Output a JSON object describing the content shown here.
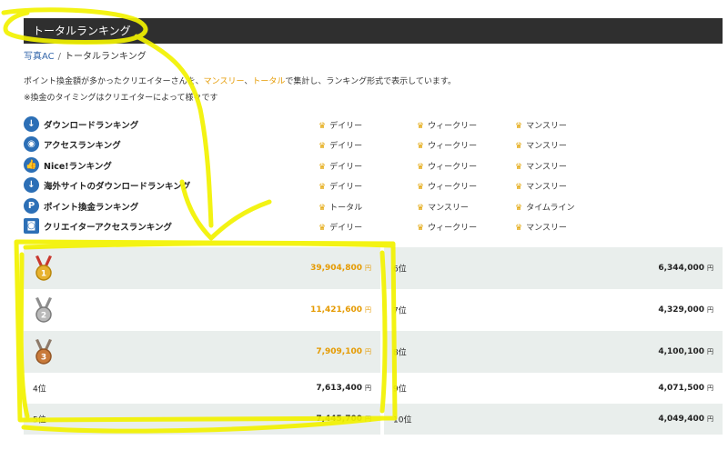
{
  "page": {
    "title": "トータルランキング"
  },
  "breadcrumb": {
    "home": "写真AC",
    "separator": "/",
    "current": "トータルランキング"
  },
  "description": {
    "line1_a": "ポイント換金額が多かったクリエイターさんを、",
    "line1_b": "マンスリー",
    "line1_c": "、",
    "line1_d": "トータル",
    "line1_e": "で集計し、ランキング形式で表示しています。",
    "line2": "※換金のタイミングはクリエイターによって様々です"
  },
  "icons": {
    "crown": "crown-icon"
  },
  "rankings": [
    {
      "name": "ダウンロードランキング",
      "icon": "download-icon",
      "glyph": "↓",
      "periods": [
        "デイリー",
        "ウィークリー",
        "マンスリー"
      ]
    },
    {
      "name": "アクセスランキング",
      "icon": "eye-icon",
      "glyph": "◉",
      "periods": [
        "デイリー",
        "ウィークリー",
        "マンスリー"
      ]
    },
    {
      "name": "Nice!ランキング",
      "icon": "thumbs-up-icon",
      "glyph": "👍",
      "periods": [
        "デイリー",
        "ウィークリー",
        "マンスリー"
      ]
    },
    {
      "name": "海外サイトのダウンロードランキング",
      "icon": "download-icon",
      "glyph": "↓",
      "periods": [
        "デイリー",
        "ウィークリー",
        "マンスリー"
      ]
    },
    {
      "name": "ポイント換金ランキング",
      "icon": "point-icon",
      "glyph": "P",
      "periods": [
        "トータル",
        "マンスリー",
        "タイムライン"
      ]
    },
    {
      "name": "クリエイターアクセスランキング",
      "icon": "camera-icon",
      "glyph": "◙",
      "periods": [
        "デイリー",
        "ウィークリー",
        "マンスリー"
      ]
    }
  ],
  "table": {
    "yen": "円",
    "left": [
      {
        "rank": "1位",
        "medal": "gold",
        "amount": "39,904,800"
      },
      {
        "rank": "2位",
        "medal": "silver",
        "amount": "11,421,600"
      },
      {
        "rank": "3位",
        "medal": "bronze",
        "amount": "7,909,100"
      },
      {
        "rank": "4位",
        "medal": "",
        "amount": "7,613,400"
      },
      {
        "rank": "5位",
        "medal": "",
        "amount": "7,445,700"
      }
    ],
    "right": [
      {
        "rank": "6位",
        "amount": "6,344,000"
      },
      {
        "rank": "7位",
        "amount": "4,329,000"
      },
      {
        "rank": "8位",
        "amount": "4,100,100"
      },
      {
        "rank": "9位",
        "amount": "4,071,500"
      },
      {
        "rank": "10位",
        "amount": "4,049,400"
      }
    ]
  },
  "colors": {
    "accent": "#e59a00",
    "header_bg": "#2f2f2f",
    "link": "#3366aa",
    "row_shade": "#e9eeec",
    "marker": "#f2f200"
  }
}
